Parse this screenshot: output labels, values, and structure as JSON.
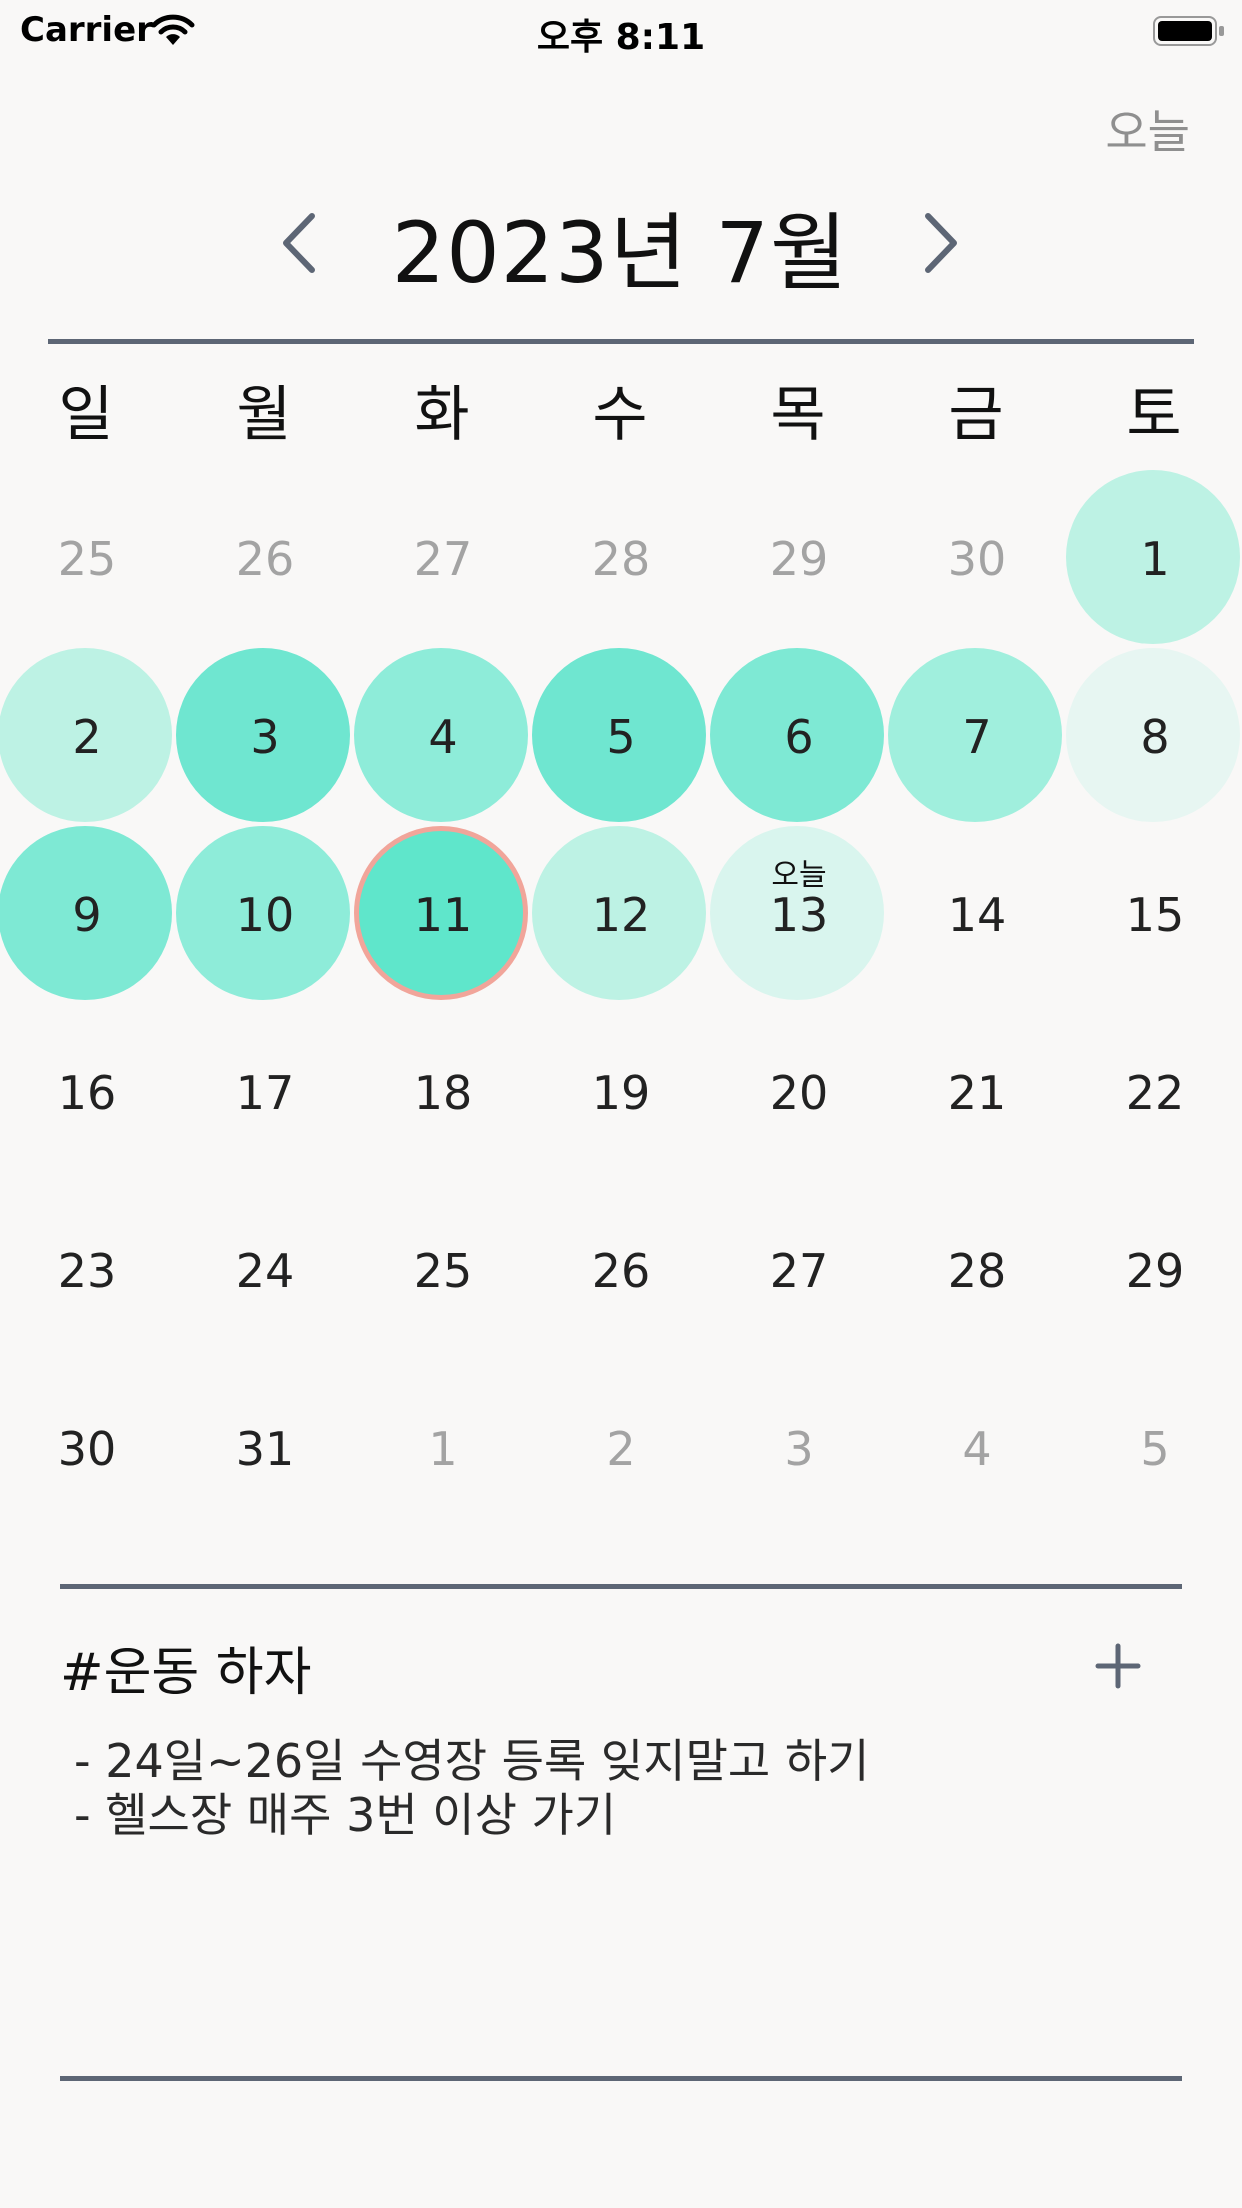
{
  "status_bar": {
    "carrier": "Carrier",
    "time": "오후 8:11"
  },
  "header": {
    "today_button": "오늘",
    "month_title": "2023년 7월"
  },
  "weekdays": [
    "일",
    "월",
    "화",
    "수",
    "목",
    "금",
    "토"
  ],
  "today_label": "오늘",
  "colors": {
    "background": "#f9f8f7",
    "divider": "#5d6675",
    "selected_border": "#f1a59a",
    "muted_text": "#a3a3a3"
  },
  "weeks": [
    [
      {
        "day": "25",
        "other": true
      },
      {
        "day": "26",
        "other": true
      },
      {
        "day": "27",
        "other": true
      },
      {
        "day": "28",
        "other": true
      },
      {
        "day": "29",
        "other": true
      },
      {
        "day": "30",
        "other": true
      },
      {
        "day": "1",
        "color": "#bdf2e4"
      }
    ],
    [
      {
        "day": "2",
        "color": "#bdf2e4"
      },
      {
        "day": "3",
        "color": "#6fe6d0"
      },
      {
        "day": "4",
        "color": "#8eecd9"
      },
      {
        "day": "5",
        "color": "#6fe6d0"
      },
      {
        "day": "6",
        "color": "#7ee9d4"
      },
      {
        "day": "7",
        "color": "#a0efdd"
      },
      {
        "day": "8",
        "color": "#e7f6f2"
      }
    ],
    [
      {
        "day": "9",
        "color": "#7ee9d4"
      },
      {
        "day": "10",
        "color": "#8eecd9"
      },
      {
        "day": "11",
        "color": "#5fe6cb",
        "selected": true
      },
      {
        "day": "12",
        "color": "#bdf2e4"
      },
      {
        "day": "13",
        "color": "#d9f5ee",
        "today": true
      },
      {
        "day": "14"
      },
      {
        "day": "15"
      }
    ],
    [
      {
        "day": "16"
      },
      {
        "day": "17"
      },
      {
        "day": "18"
      },
      {
        "day": "19"
      },
      {
        "day": "20"
      },
      {
        "day": "21"
      },
      {
        "day": "22"
      }
    ],
    [
      {
        "day": "23"
      },
      {
        "day": "24"
      },
      {
        "day": "25"
      },
      {
        "day": "26"
      },
      {
        "day": "27"
      },
      {
        "day": "28"
      },
      {
        "day": "29"
      }
    ],
    [
      {
        "day": "30"
      },
      {
        "day": "31"
      },
      {
        "day": "1",
        "other": true
      },
      {
        "day": "2",
        "other": true
      },
      {
        "day": "3",
        "other": true
      },
      {
        "day": "4",
        "other": true
      },
      {
        "day": "5",
        "other": true
      }
    ]
  ],
  "memo": {
    "title": "#운동 하자",
    "lines": [
      "- 24일~26일 수영장 등록 잊지말고 하기",
      "- 헬스장 매주 3번 이상 가기"
    ]
  }
}
